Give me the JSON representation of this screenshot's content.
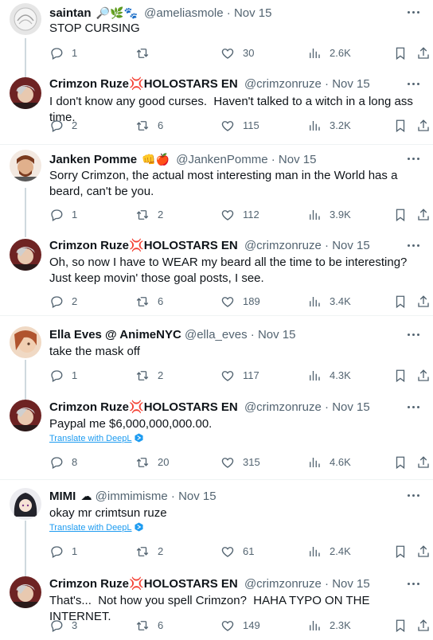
{
  "tweets": [
    {
      "name": "saintan",
      "name_emoji": "🔎🌿🐾",
      "handle": "@ameliasmole",
      "date": "Nov 15",
      "text": "STOP CURSING",
      "translate": "",
      "reply_count": "1",
      "retweet_count": "",
      "like_count": "30",
      "view_count": "2.6K",
      "avatar_color": "#d9d9d9"
    },
    {
      "name": "Crimzon Ruze",
      "name_emoji": "💢HOLOSTARS EN",
      "handle": "@crimzonruze",
      "date": "Nov 15",
      "text": "I don't know any good curses.  Haven't talked to a witch in a long ass time.",
      "translate": "",
      "reply_count": "2",
      "retweet_count": "6",
      "like_count": "115",
      "view_count": "3.2K",
      "avatar_color": "#7a2a2a"
    },
    {
      "name": "Janken Pomme",
      "name_emoji": "👊🍎",
      "handle": "@JankenPomme",
      "date": "Nov 15",
      "text": "Sorry Crimzon, the actual most interesting man in the World has a beard, can't be you.",
      "translate": "",
      "reply_count": "1",
      "retweet_count": "2",
      "like_count": "112",
      "view_count": "3.9K",
      "avatar_color": "#8a4a2a"
    },
    {
      "name": "Crimzon Ruze",
      "name_emoji": "💢HOLOSTARS EN",
      "handle": "@crimzonruze",
      "date": "Nov 15",
      "text": "Oh, so now I have to WEAR my beard all the time to be interesting?  Just keep movin' those goal posts, I see.",
      "translate": "",
      "reply_count": "2",
      "retweet_count": "6",
      "like_count": "189",
      "view_count": "3.4K",
      "avatar_color": "#7a2a2a"
    },
    {
      "name": "Ella Eves @ AnimeNYC",
      "name_emoji": "",
      "handle": "@ella_eves",
      "date": "Nov 15",
      "text": "take the mask off",
      "translate": "",
      "reply_count": "1",
      "retweet_count": "2",
      "like_count": "117",
      "view_count": "4.3K",
      "avatar_color": "#b5734a"
    },
    {
      "name": "Crimzon Ruze",
      "name_emoji": "💢HOLOSTARS EN",
      "handle": "@crimzonruze",
      "date": "Nov 15",
      "text": "Paypal me $6,000,000,000.00.",
      "translate": "Translate with DeepL",
      "reply_count": "8",
      "retweet_count": "20",
      "like_count": "315",
      "view_count": "4.6K",
      "avatar_color": "#7a2a2a"
    },
    {
      "name": "MIMI",
      "name_emoji": "☁",
      "handle": "@immimisme",
      "date": "Nov 15",
      "text": "okay mr crimtsun ruze",
      "translate": "Translate with DeepL",
      "reply_count": "1",
      "retweet_count": "2",
      "like_count": "61",
      "view_count": "2.4K",
      "avatar_color": "#2a2a35"
    },
    {
      "name": "Crimzon Ruze",
      "name_emoji": "💢HOLOSTARS EN",
      "handle": "@crimzonruze",
      "date": "Nov 15",
      "text": "That's...  Not how you spell Crimzon?  HAHA TYPO ON THE INTERNET.",
      "translate": "",
      "reply_count": "3",
      "retweet_count": "6",
      "like_count": "149",
      "view_count": "2.3K",
      "avatar_color": "#7a2a2a"
    }
  ],
  "colors": {
    "text_primary": "#0f1419",
    "text_secondary": "#536471",
    "link": "#1d9bf0",
    "thread_line": "#cfd9de",
    "divider": "#eff3f4"
  },
  "icons": [
    "reply-icon",
    "retweet-icon",
    "like-icon",
    "views-icon",
    "bookmark-icon",
    "share-icon",
    "more-icon",
    "deepl-icon"
  ]
}
